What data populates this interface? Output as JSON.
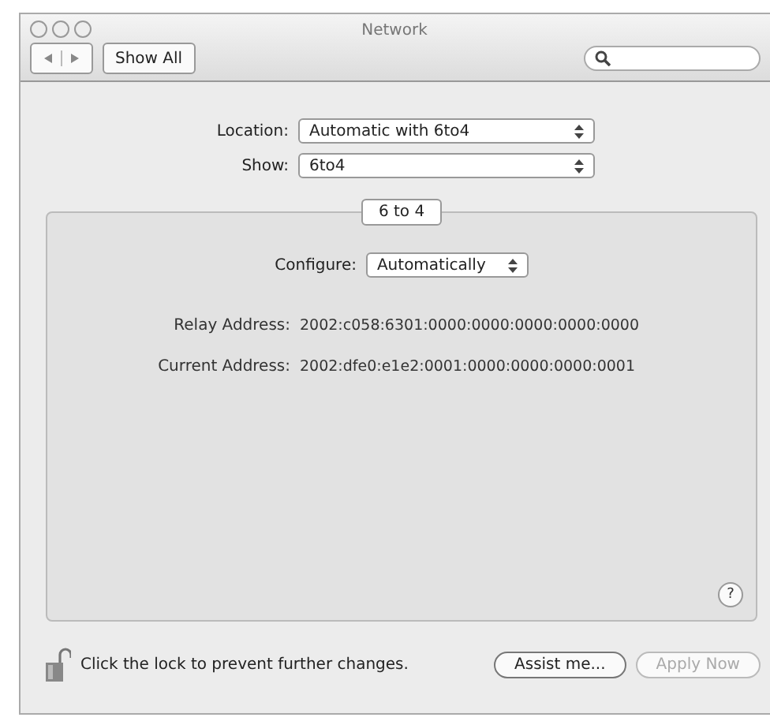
{
  "window": {
    "title": "Network"
  },
  "toolbar": {
    "show_all": "Show All"
  },
  "location": {
    "label": "Location:",
    "value": "Automatic with 6to4"
  },
  "show": {
    "label": "Show:",
    "value": "6to4"
  },
  "tabs": [
    {
      "label": "6 to 4",
      "selected": true
    }
  ],
  "configure": {
    "label": "Configure:",
    "value": "Automatically"
  },
  "addresses": [
    {
      "label": "Relay Address:",
      "value": "2002:c058:6301:0000:0000:0000:0000:0000"
    },
    {
      "label": "Current Address:",
      "value": "2002:dfe0:e1e2:0001:0000:0000:0000:0001"
    }
  ],
  "help": "?",
  "lock": {
    "text": "Click the lock to prevent further changes."
  },
  "buttons": [
    {
      "label": "Assist me...",
      "disabled": false
    },
    {
      "label": "Apply Now",
      "disabled": true
    }
  ]
}
